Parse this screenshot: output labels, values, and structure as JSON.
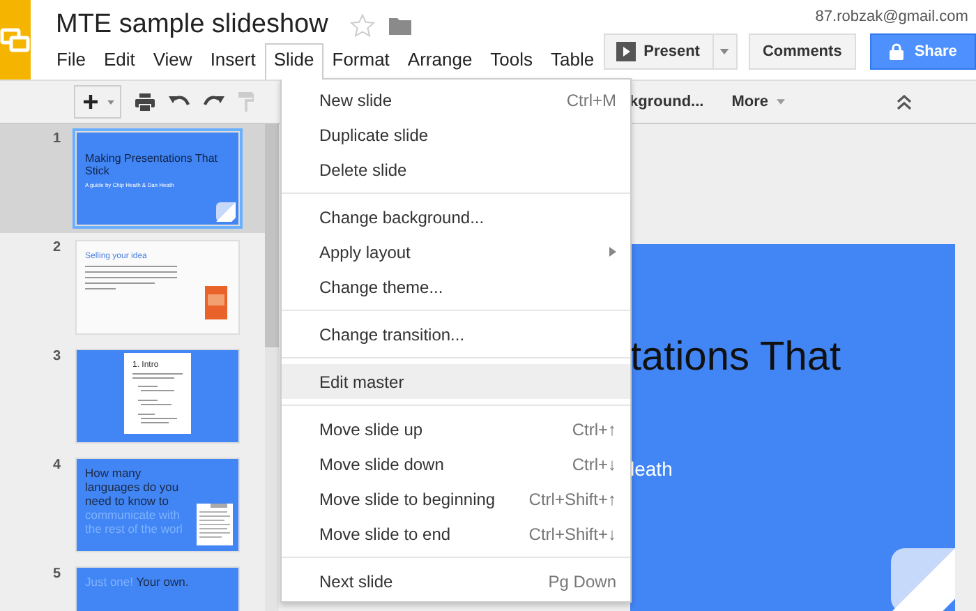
{
  "document": {
    "title": "MTE sample slideshow",
    "starred": false
  },
  "menubar": [
    {
      "label": "File",
      "selected": false
    },
    {
      "label": "Edit",
      "selected": false
    },
    {
      "label": "View",
      "selected": false
    },
    {
      "label": "Insert",
      "selected": false
    },
    {
      "label": "Slide",
      "selected": true
    },
    {
      "label": "Format",
      "selected": false
    },
    {
      "label": "Arrange",
      "selected": false
    },
    {
      "label": "Tools",
      "selected": false
    },
    {
      "label": "Table",
      "selected": false
    }
  ],
  "account": {
    "email": "87.robzak@gmail.com"
  },
  "buttons": {
    "present": "Present",
    "comments": "Comments",
    "share": "Share"
  },
  "toolbar": {
    "background_button": "kground...",
    "more_button": "More"
  },
  "slide_menu": [
    {
      "kind": "item",
      "label": "New slide",
      "shortcut": "Ctrl+M",
      "submenu": false,
      "selected": false
    },
    {
      "kind": "item",
      "label": "Duplicate slide",
      "submenu": false,
      "selected": false
    },
    {
      "kind": "item",
      "label": "Delete slide",
      "submenu": false,
      "selected": false
    },
    {
      "kind": "separator"
    },
    {
      "kind": "item",
      "label": "Change background...",
      "submenu": false,
      "selected": false
    },
    {
      "kind": "item",
      "label": "Apply layout",
      "submenu": true,
      "selected": false
    },
    {
      "kind": "item",
      "label": "Change theme...",
      "submenu": false,
      "selected": false
    },
    {
      "kind": "separator"
    },
    {
      "kind": "item",
      "label": "Change transition...",
      "submenu": false,
      "selected": false
    },
    {
      "kind": "separator"
    },
    {
      "kind": "item",
      "label": "Edit master",
      "submenu": false,
      "selected": true
    },
    {
      "kind": "separator"
    },
    {
      "kind": "item",
      "label": "Move slide up",
      "shortcut": "Ctrl+↑",
      "submenu": false,
      "selected": false
    },
    {
      "kind": "item",
      "label": "Move slide down",
      "shortcut": "Ctrl+↓",
      "submenu": false,
      "selected": false
    },
    {
      "kind": "item",
      "label": "Move slide to beginning",
      "shortcut": "Ctrl+Shift+↑",
      "submenu": false,
      "selected": false
    },
    {
      "kind": "item",
      "label": "Move slide to end",
      "shortcut": "Ctrl+Shift+↓",
      "submenu": false,
      "selected": false
    },
    {
      "kind": "separator"
    },
    {
      "kind": "item",
      "label": "Next slide",
      "shortcut": "Pg Down",
      "submenu": false,
      "selected": false
    }
  ],
  "slides": [
    {
      "number": "1",
      "kind": "title",
      "selected": true,
      "title": "Making Presentations That Stick",
      "subtitle": "A guide by Chip Heath & Dan Heath"
    },
    {
      "number": "2",
      "kind": "text",
      "selected": false,
      "title": "Selling your idea"
    },
    {
      "number": "3",
      "kind": "doc",
      "selected": false,
      "title": "1. Intro"
    },
    {
      "number": "4",
      "kind": "quote",
      "selected": false,
      "dark_text": "How many languages do you need to know to",
      "light_text": "communicate with the rest of the worl"
    },
    {
      "number": "5",
      "kind": "quote",
      "selected": false,
      "light_text": "Just one!",
      "dark_text": "Your own."
    }
  ],
  "canvas": {
    "title": "tations That",
    "subtitle": "leath"
  }
}
